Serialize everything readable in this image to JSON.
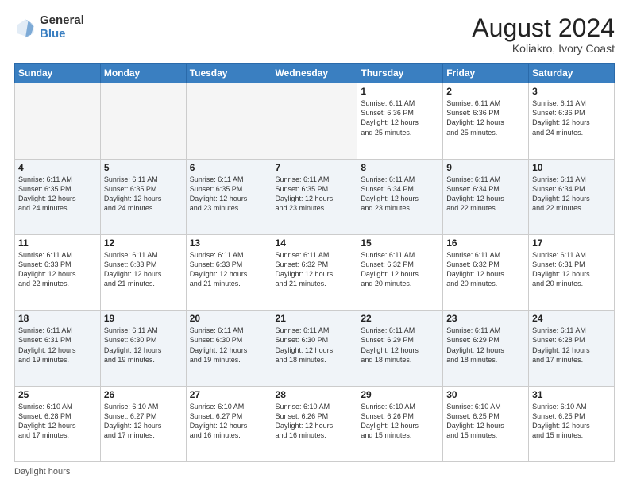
{
  "header": {
    "logo_general": "General",
    "logo_blue": "Blue",
    "month_year": "August 2024",
    "location": "Koliakro, Ivory Coast"
  },
  "days_of_week": [
    "Sunday",
    "Monday",
    "Tuesday",
    "Wednesday",
    "Thursday",
    "Friday",
    "Saturday"
  ],
  "footer": {
    "label": "Daylight hours"
  },
  "weeks": [
    [
      {
        "day": "",
        "info": ""
      },
      {
        "day": "",
        "info": ""
      },
      {
        "day": "",
        "info": ""
      },
      {
        "day": "",
        "info": ""
      },
      {
        "day": "1",
        "info": "Sunrise: 6:11 AM\nSunset: 6:36 PM\nDaylight: 12 hours\nand 25 minutes."
      },
      {
        "day": "2",
        "info": "Sunrise: 6:11 AM\nSunset: 6:36 PM\nDaylight: 12 hours\nand 25 minutes."
      },
      {
        "day": "3",
        "info": "Sunrise: 6:11 AM\nSunset: 6:36 PM\nDaylight: 12 hours\nand 24 minutes."
      }
    ],
    [
      {
        "day": "4",
        "info": "Sunrise: 6:11 AM\nSunset: 6:35 PM\nDaylight: 12 hours\nand 24 minutes."
      },
      {
        "day": "5",
        "info": "Sunrise: 6:11 AM\nSunset: 6:35 PM\nDaylight: 12 hours\nand 24 minutes."
      },
      {
        "day": "6",
        "info": "Sunrise: 6:11 AM\nSunset: 6:35 PM\nDaylight: 12 hours\nand 23 minutes."
      },
      {
        "day": "7",
        "info": "Sunrise: 6:11 AM\nSunset: 6:35 PM\nDaylight: 12 hours\nand 23 minutes."
      },
      {
        "day": "8",
        "info": "Sunrise: 6:11 AM\nSunset: 6:34 PM\nDaylight: 12 hours\nand 23 minutes."
      },
      {
        "day": "9",
        "info": "Sunrise: 6:11 AM\nSunset: 6:34 PM\nDaylight: 12 hours\nand 22 minutes."
      },
      {
        "day": "10",
        "info": "Sunrise: 6:11 AM\nSunset: 6:34 PM\nDaylight: 12 hours\nand 22 minutes."
      }
    ],
    [
      {
        "day": "11",
        "info": "Sunrise: 6:11 AM\nSunset: 6:33 PM\nDaylight: 12 hours\nand 22 minutes."
      },
      {
        "day": "12",
        "info": "Sunrise: 6:11 AM\nSunset: 6:33 PM\nDaylight: 12 hours\nand 21 minutes."
      },
      {
        "day": "13",
        "info": "Sunrise: 6:11 AM\nSunset: 6:33 PM\nDaylight: 12 hours\nand 21 minutes."
      },
      {
        "day": "14",
        "info": "Sunrise: 6:11 AM\nSunset: 6:32 PM\nDaylight: 12 hours\nand 21 minutes."
      },
      {
        "day": "15",
        "info": "Sunrise: 6:11 AM\nSunset: 6:32 PM\nDaylight: 12 hours\nand 20 minutes."
      },
      {
        "day": "16",
        "info": "Sunrise: 6:11 AM\nSunset: 6:32 PM\nDaylight: 12 hours\nand 20 minutes."
      },
      {
        "day": "17",
        "info": "Sunrise: 6:11 AM\nSunset: 6:31 PM\nDaylight: 12 hours\nand 20 minutes."
      }
    ],
    [
      {
        "day": "18",
        "info": "Sunrise: 6:11 AM\nSunset: 6:31 PM\nDaylight: 12 hours\nand 19 minutes."
      },
      {
        "day": "19",
        "info": "Sunrise: 6:11 AM\nSunset: 6:30 PM\nDaylight: 12 hours\nand 19 minutes."
      },
      {
        "day": "20",
        "info": "Sunrise: 6:11 AM\nSunset: 6:30 PM\nDaylight: 12 hours\nand 19 minutes."
      },
      {
        "day": "21",
        "info": "Sunrise: 6:11 AM\nSunset: 6:30 PM\nDaylight: 12 hours\nand 18 minutes."
      },
      {
        "day": "22",
        "info": "Sunrise: 6:11 AM\nSunset: 6:29 PM\nDaylight: 12 hours\nand 18 minutes."
      },
      {
        "day": "23",
        "info": "Sunrise: 6:11 AM\nSunset: 6:29 PM\nDaylight: 12 hours\nand 18 minutes."
      },
      {
        "day": "24",
        "info": "Sunrise: 6:11 AM\nSunset: 6:28 PM\nDaylight: 12 hours\nand 17 minutes."
      }
    ],
    [
      {
        "day": "25",
        "info": "Sunrise: 6:10 AM\nSunset: 6:28 PM\nDaylight: 12 hours\nand 17 minutes."
      },
      {
        "day": "26",
        "info": "Sunrise: 6:10 AM\nSunset: 6:27 PM\nDaylight: 12 hours\nand 17 minutes."
      },
      {
        "day": "27",
        "info": "Sunrise: 6:10 AM\nSunset: 6:27 PM\nDaylight: 12 hours\nand 16 minutes."
      },
      {
        "day": "28",
        "info": "Sunrise: 6:10 AM\nSunset: 6:26 PM\nDaylight: 12 hours\nand 16 minutes."
      },
      {
        "day": "29",
        "info": "Sunrise: 6:10 AM\nSunset: 6:26 PM\nDaylight: 12 hours\nand 15 minutes."
      },
      {
        "day": "30",
        "info": "Sunrise: 6:10 AM\nSunset: 6:25 PM\nDaylight: 12 hours\nand 15 minutes."
      },
      {
        "day": "31",
        "info": "Sunrise: 6:10 AM\nSunset: 6:25 PM\nDaylight: 12 hours\nand 15 minutes."
      }
    ]
  ]
}
